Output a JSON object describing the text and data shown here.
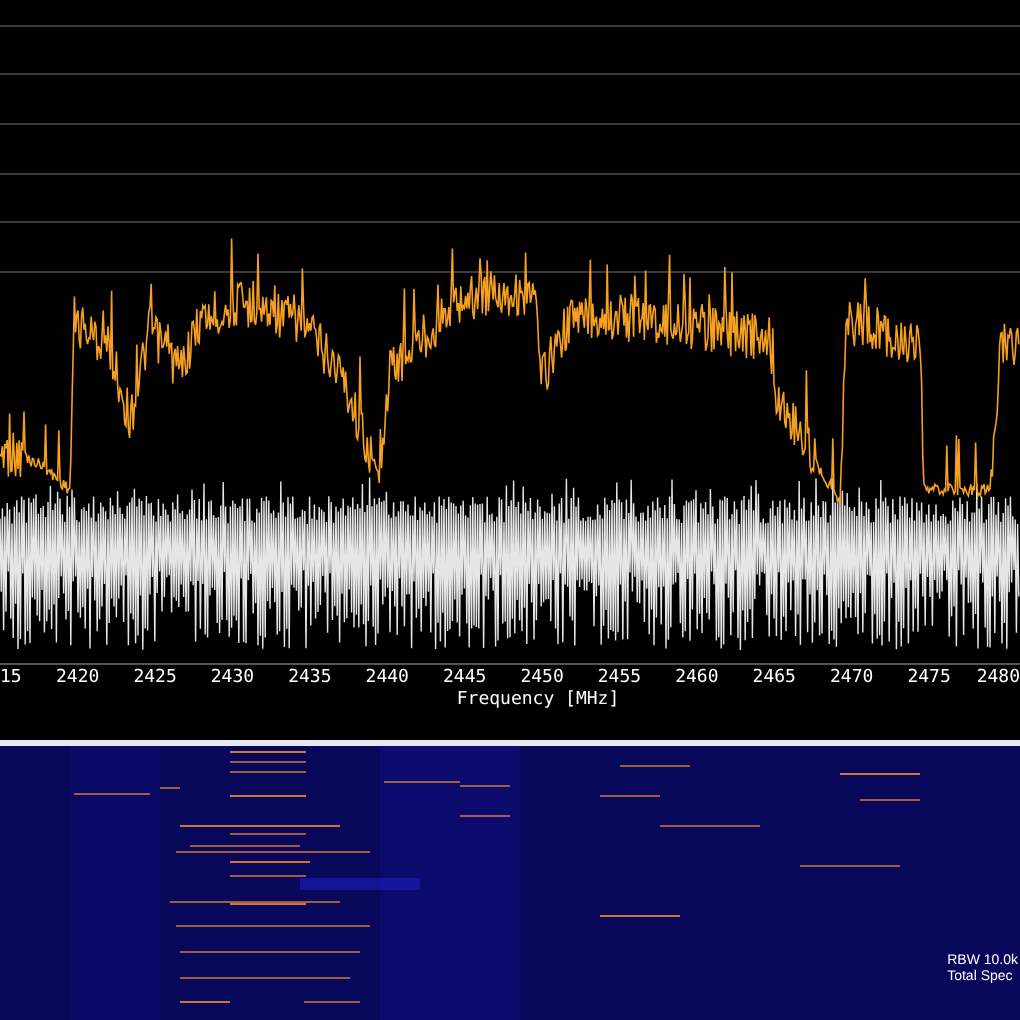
{
  "spectrum": {
    "x_axis": {
      "ticks": [
        "15",
        "2420",
        "2425",
        "2430",
        "2435",
        "2440",
        "2445",
        "2450",
        "2455",
        "2460",
        "2465",
        "2470",
        "2475",
        "2480"
      ],
      "label": "Frequency [MHz]"
    }
  },
  "waterfall": {
    "info_lines": [
      "RBW 10.0k",
      "Total Spec"
    ]
  }
}
